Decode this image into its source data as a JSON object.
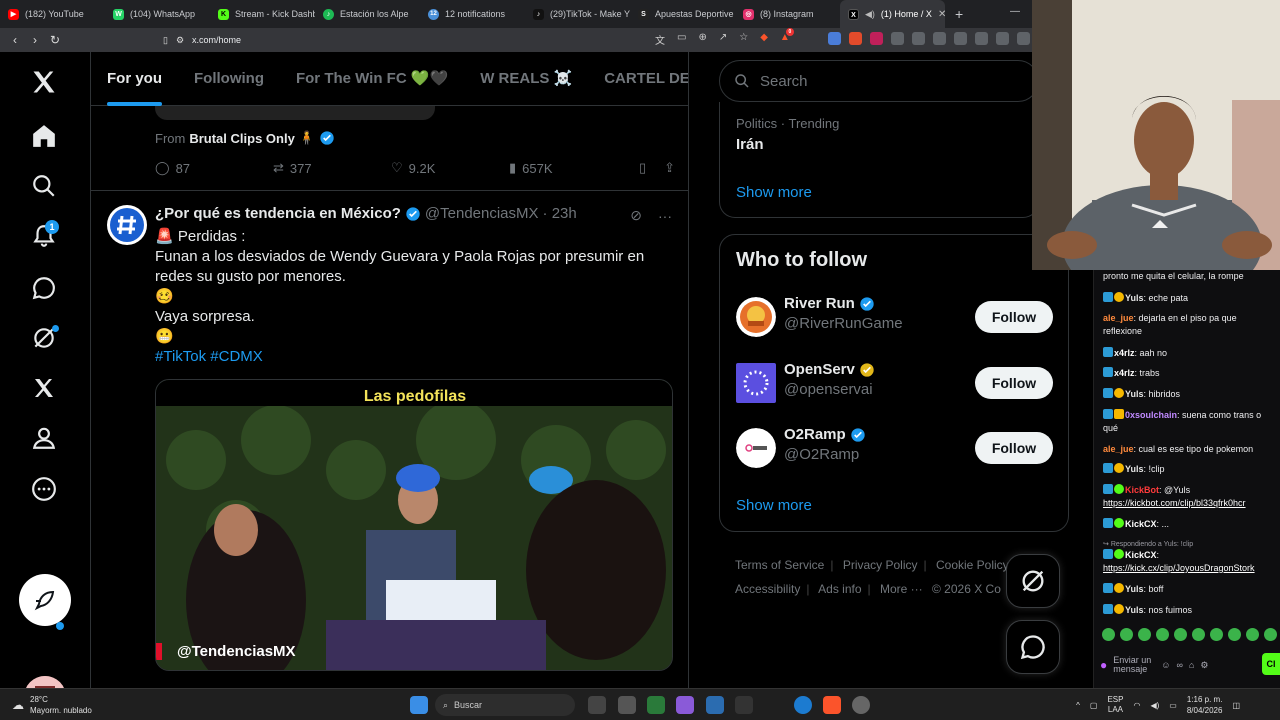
{
  "browser": {
    "tabs": [
      {
        "label": "(182) YouTube",
        "color": "#ff0000",
        "glyph": "▶"
      },
      {
        "label": "(104) WhatsApp",
        "color": "#25d366",
        "glyph": "W"
      },
      {
        "label": "Stream - Kick Dashb",
        "color": "#53fc18",
        "glyph": "K"
      },
      {
        "label": "Estación los Alpe",
        "color": "#1db954",
        "glyph": "♪"
      },
      {
        "label": "12 notifications",
        "color": "#4a90d9",
        "glyph": "12"
      },
      {
        "label": "(29)TikTok - Make Y",
        "color": "#111111",
        "glyph": "♪"
      },
      {
        "label": "Apuestas Deportive",
        "color": "#222222",
        "glyph": "S"
      },
      {
        "label": "(8) Instagram",
        "color": "#e1306c",
        "glyph": "◎"
      },
      {
        "label": "(1) Home / X",
        "color": "#000000",
        "glyph": "X",
        "active": true
      }
    ],
    "url": "x.com/home",
    "extension_badge": "0"
  },
  "nav": {
    "notifications_badge": "1"
  },
  "timeline": {
    "tabs": [
      "For you",
      "Following",
      "For The Win FC 💚🖤",
      "W REALS ☠️",
      "CARTEL DE LO"
    ],
    "prev_post": {
      "from_prefix": "From",
      "from_name": "Brutal Clips Only",
      "replies": "87",
      "reposts": "377",
      "likes": "9.2K",
      "views": "657K"
    },
    "post": {
      "name": "¿Por qué es tendencia en México?",
      "handle": "@TendenciasMX",
      "time": "· 23h",
      "line1": "🚨 Perdidas :",
      "line2": "Funan a los desviados de Wendy Guevara y Paola Rojas por presumir en redes su gusto por menores.",
      "line3": "🥴",
      "line4": "Vaya sorpresa.",
      "line5": "😬",
      "hashtags": "#TikTok #CDMX",
      "media_caption": "Las pedofilas",
      "media_watermark": "@TendenciasMX"
    }
  },
  "sidebar": {
    "search_placeholder": "Search",
    "trend": {
      "meta": "Politics · Trending",
      "name": "Irán",
      "show_more": "Show more"
    },
    "who_to_follow": {
      "title": "Who to follow",
      "accounts": [
        {
          "name": "River Run",
          "handle": "@RiverRunGame",
          "button": "Follow",
          "badge_color": "#1d9bf0"
        },
        {
          "name": "OpenServ",
          "handle": "@openservai",
          "button": "Follow",
          "badge_color": "#e2b719"
        },
        {
          "name": "O2Ramp",
          "handle": "@O2Ramp",
          "button": "Follow",
          "badge_color": "#1d9bf0"
        }
      ],
      "show_more": "Show more"
    },
    "footer": {
      "terms": "Terms of Service",
      "privacy": "Privacy Policy",
      "cookie": "Cookie Policy",
      "accessibility": "Accessibility",
      "ads": "Ads info",
      "more": "More ···",
      "copyright": "© 2026 X Co"
    }
  },
  "chat": {
    "messages": [
      {
        "user": "",
        "text": "pronto me quita el celular, la rompe"
      },
      {
        "user": "Yuls",
        "text": ": eche pata"
      },
      {
        "user": "ale_jue",
        "text": ": dejarla en el piso pa que reflexione"
      },
      {
        "user": "x4rlz",
        "text": ": aah no"
      },
      {
        "user": "x4rlz",
        "text": ": trabs"
      },
      {
        "user": "Yuls",
        "text": ": hibridos"
      },
      {
        "user": "0xsoulchain",
        "text": ": suena como trans o qué"
      },
      {
        "user": "ale_jue",
        "text": ": cual es ese tipo de pokemon"
      },
      {
        "user": "Yuls",
        "text": ": !clip"
      },
      {
        "user": "KickBot",
        "text": ": @Yuls"
      },
      {
        "user": "",
        "text": "https://kickbot.com/clip/bl33qfrk0hcr"
      },
      {
        "user": "KickCX",
        "text": ": ..."
      },
      {
        "user": "",
        "text": "Respondiendo a Yuls: !clip"
      },
      {
        "user": "KickCX",
        "text": ":"
      },
      {
        "user": "",
        "text": "https://kick.cx/clip/JoyousDragonStork"
      },
      {
        "user": "Yuls",
        "text": ": boff"
      },
      {
        "user": "Yuls",
        "text": ": nos fuimos"
      }
    ],
    "input_placeholder": "Enviar un mensaje",
    "send_label": "Cl"
  },
  "taskbar": {
    "temp": "28°C",
    "weather": "Mayorm. nublado",
    "search": "Buscar",
    "lang": "ESP",
    "lang2": "LAA",
    "time": "1:16 p. m.",
    "date": "8/04/2026"
  }
}
